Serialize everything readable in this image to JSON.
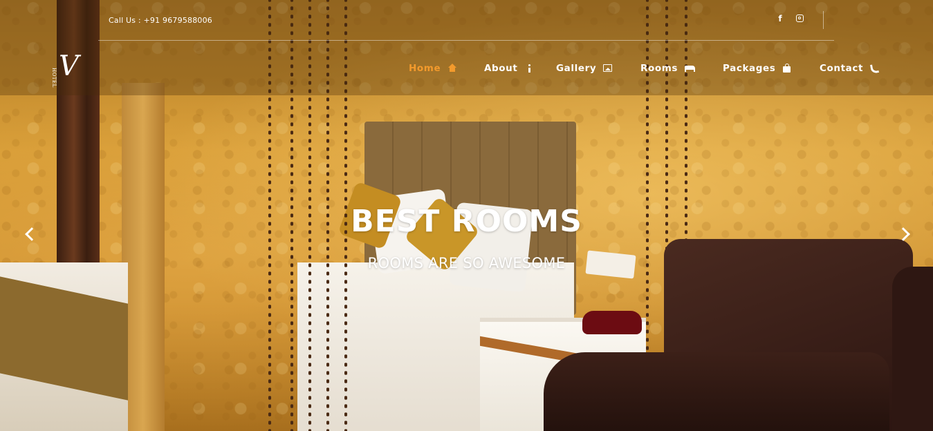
{
  "topbar": {
    "call_us": "Call Us : +91 9679588006",
    "social": [
      {
        "icon": "facebook-icon",
        "glyph": "f"
      },
      {
        "icon": "instagram-icon"
      }
    ]
  },
  "logo": {
    "letter": "V",
    "word": "HOTEL"
  },
  "nav": {
    "items": [
      {
        "label": "Home",
        "icon": "home-icon",
        "active": true
      },
      {
        "label": "About",
        "icon": "info-icon",
        "active": false
      },
      {
        "label": "Gallery",
        "icon": "image-icon",
        "active": false
      },
      {
        "label": "Rooms",
        "icon": "bed-icon",
        "active": false
      },
      {
        "label": "Packages",
        "icon": "shopping-bag-icon",
        "active": false
      },
      {
        "label": "Contact",
        "icon": "phone-icon",
        "active": false
      }
    ]
  },
  "hero": {
    "title": "BEST ROOMS",
    "subtitle": "ROOMS ARE SO AWESOME"
  },
  "colors": {
    "accent": "#f39a2c",
    "text": "#ffffff",
    "header_overlay": "rgba(70,45,8,0.32)"
  }
}
